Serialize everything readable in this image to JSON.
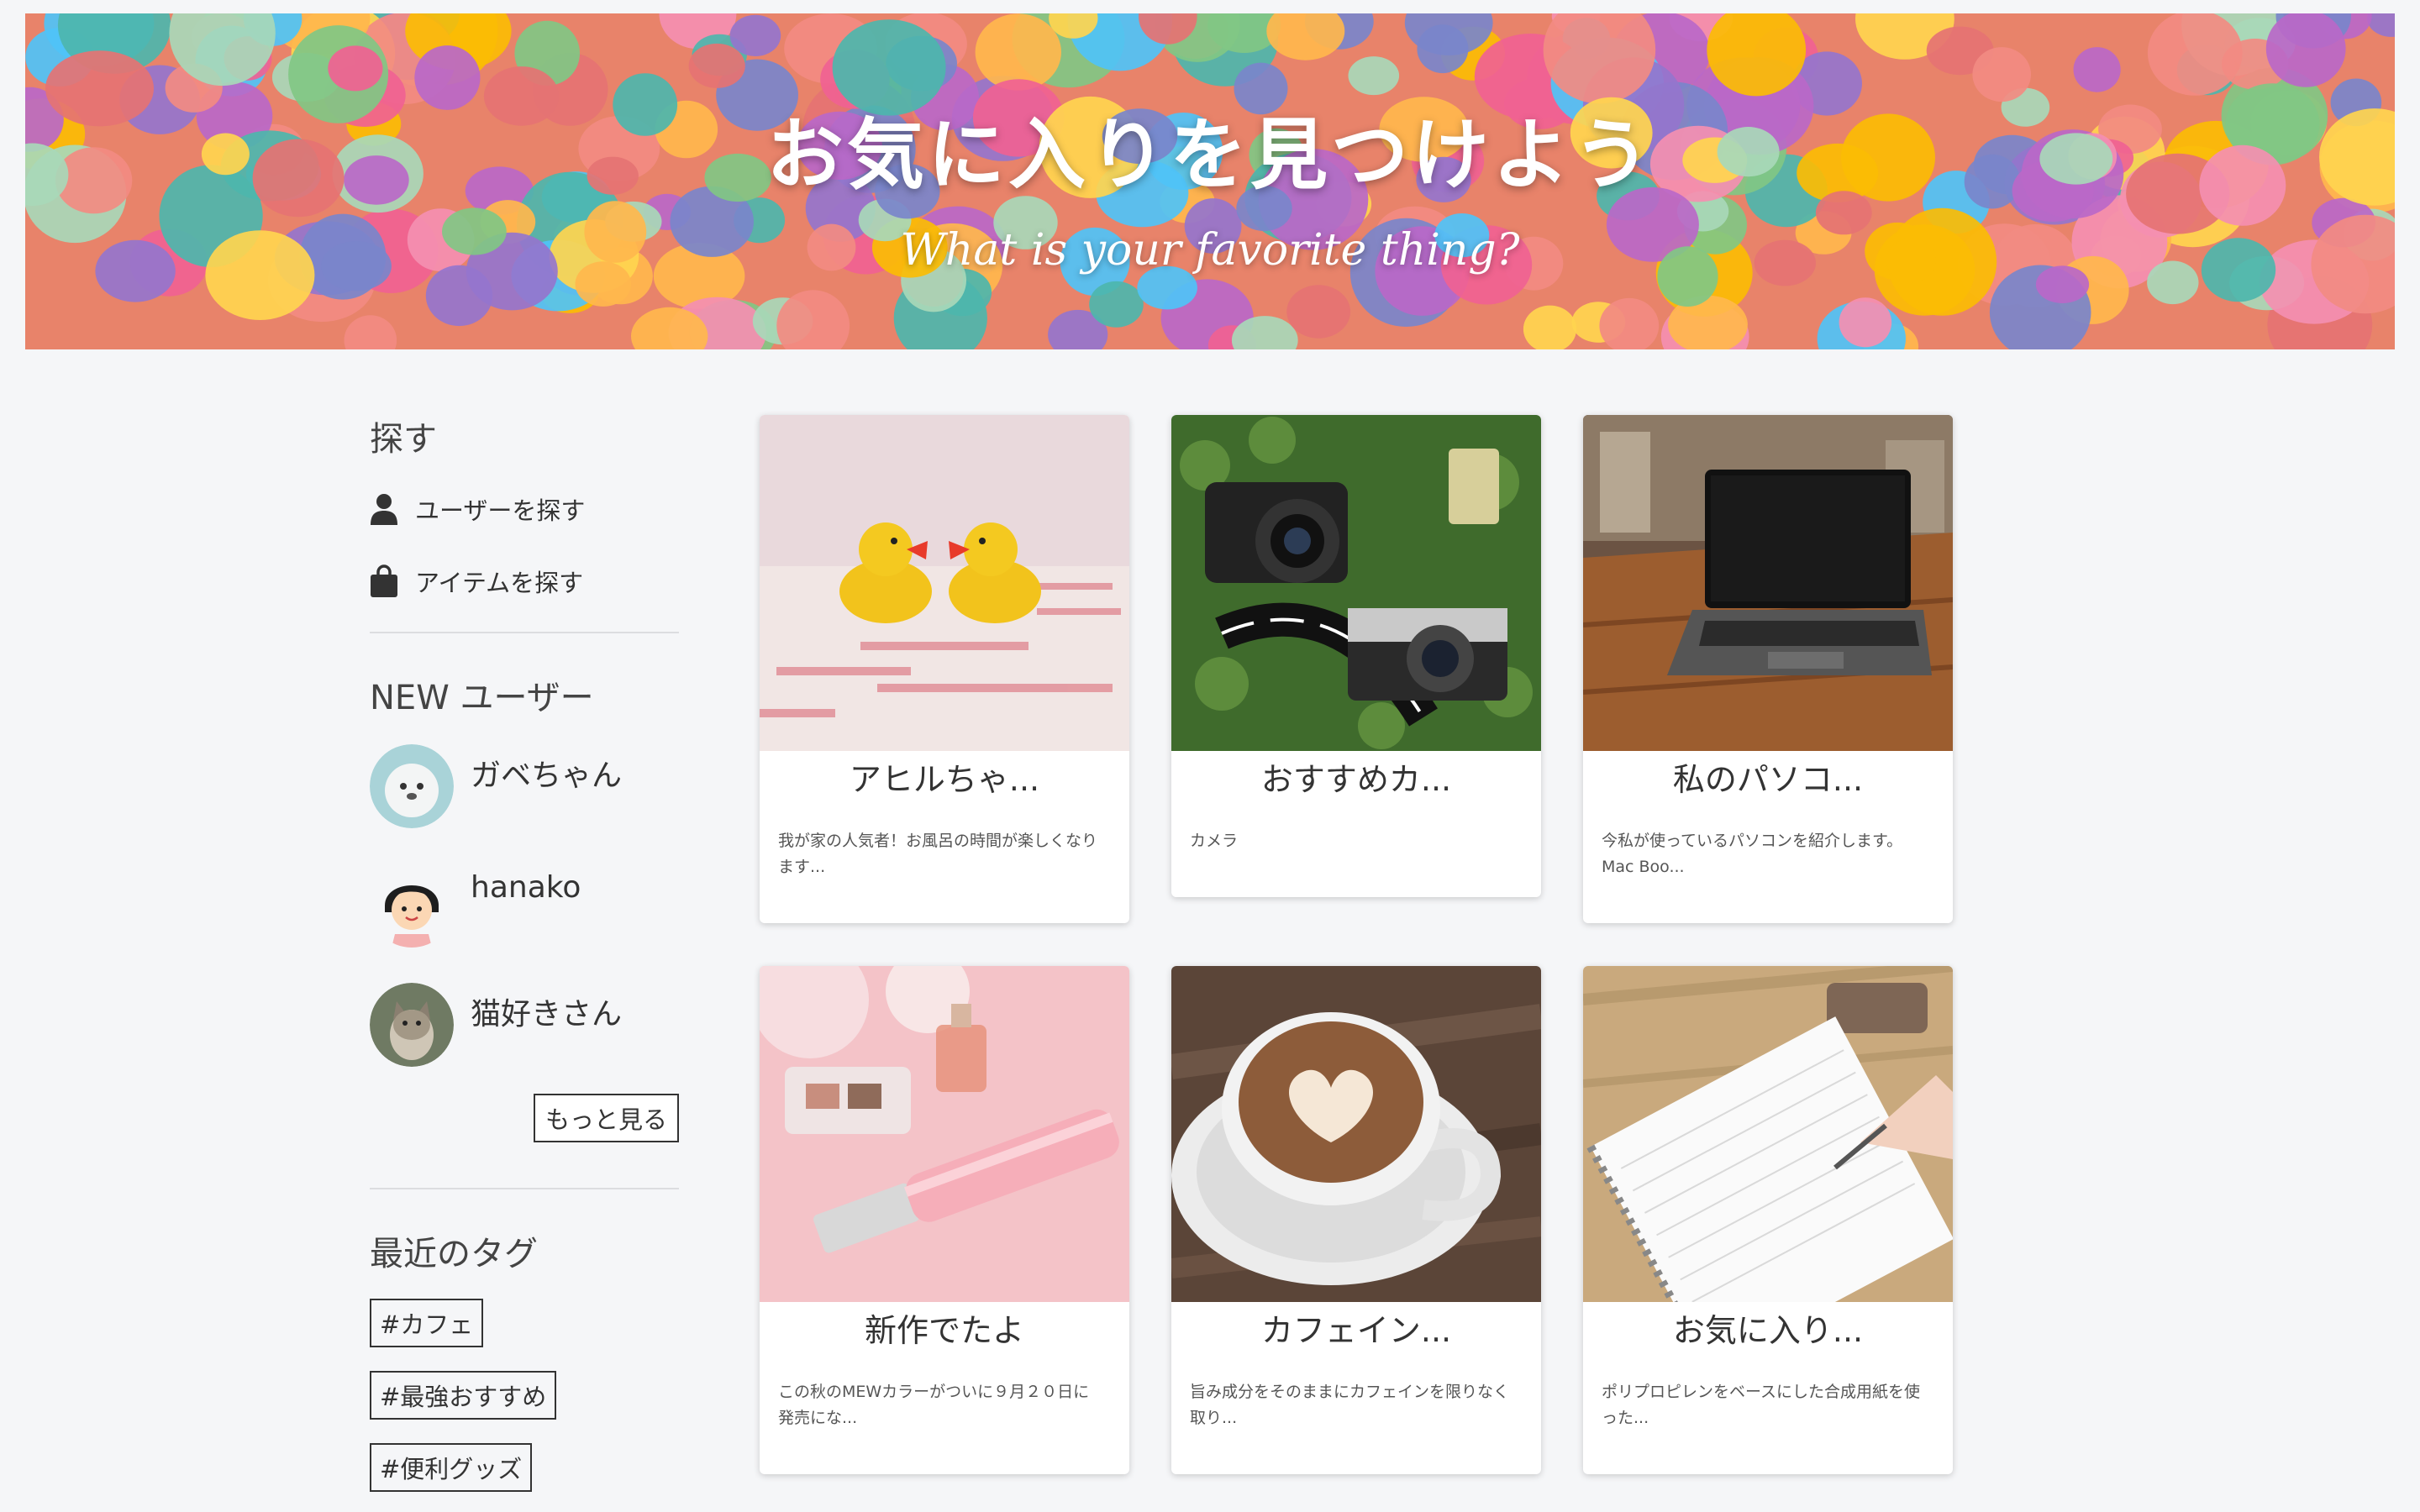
{
  "hero": {
    "title": "お気に入りを見つけよう",
    "subtitle": "What is your favorite thing?"
  },
  "sidebar": {
    "search_heading": "探す",
    "search_links": [
      {
        "icon": "user-icon",
        "label": "ユーザーを探す"
      },
      {
        "icon": "shopping-bag-icon",
        "label": "アイテムを探す"
      }
    ],
    "new_users_heading": "NEW ユーザー",
    "new_users": [
      {
        "name": "ガベちゃん",
        "avatar": "seal-avatar"
      },
      {
        "name": "hanako",
        "avatar": "girl-avatar"
      },
      {
        "name": "猫好きさん",
        "avatar": "cat-avatar"
      }
    ],
    "more_label": "もっと見る",
    "recent_tags_heading": "最近のタグ",
    "tags": [
      "#カフェ",
      "#最強おすすめ",
      "#便利グッズ"
    ]
  },
  "items": [
    {
      "title": "アヒルちゃ...",
      "desc_line1": "我が家の人気者！お風呂の時間が楽しくなり",
      "desc_line2": "ます...",
      "image": "rubber-ducks-image"
    },
    {
      "title": "おすすめカ...",
      "desc_line1": "カメラ",
      "desc_line2": "",
      "image": "cameras-image"
    },
    {
      "title": "私のパソコ...",
      "desc_line1": "今私が使っているパソコンを紹介します。",
      "desc_line2": "Mac Boo...",
      "image": "laptop-image"
    },
    {
      "title": "新作でたよ",
      "desc_line1": "この秋のMEWカラーがついに９月２０日に",
      "desc_line2": "発売にな...",
      "image": "lip-gloss-image"
    },
    {
      "title": "カフェイン...",
      "desc_line1": "旨み成分をそのままにカフェインを限りなく",
      "desc_line2": "取り...",
      "image": "coffee-image"
    },
    {
      "title": "お気に入り...",
      "desc_line1": "ポリプロピレンをベースにした合成用紙を使",
      "desc_line2": "った...",
      "image": "notebook-image"
    }
  ],
  "colors": {
    "page_background": "#f5f6f8",
    "text": "#333333",
    "divider": "#dcdde0"
  }
}
